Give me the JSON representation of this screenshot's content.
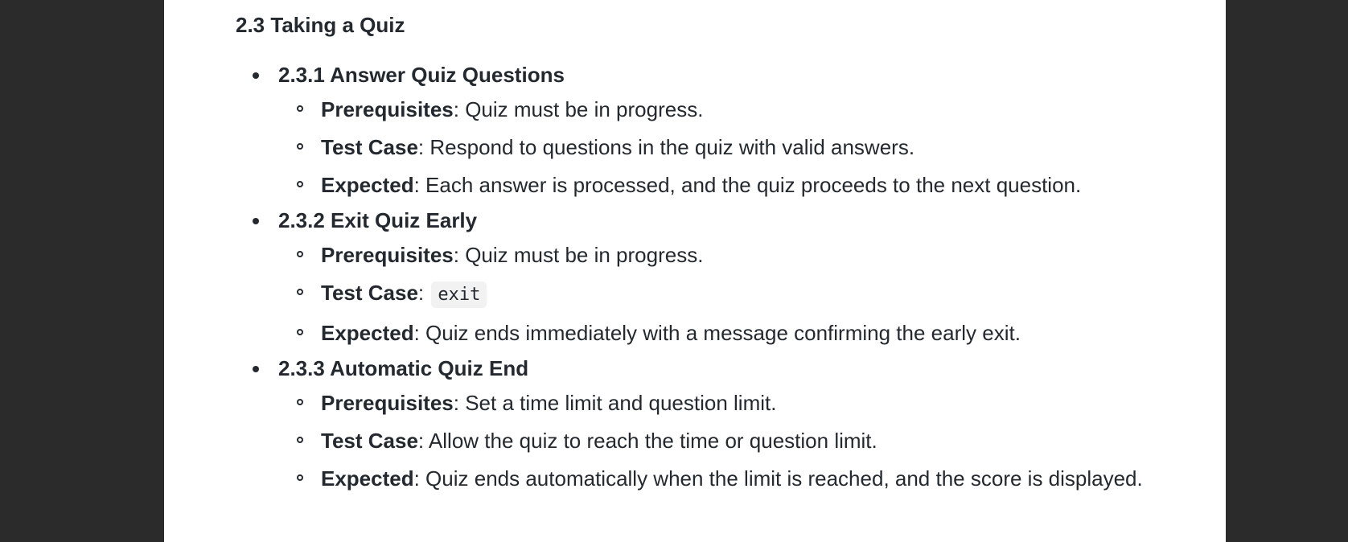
{
  "section": {
    "title": "2.3 Taking a Quiz"
  },
  "items": [
    {
      "heading": "2.3.1 Answer Quiz Questions",
      "prereq_label": "Prerequisites",
      "prereq_text": ": Quiz must be in progress.",
      "test_label": "Test Case",
      "test_text": ": Respond to questions in the quiz with valid answers.",
      "expected_label": "Expected",
      "expected_text": ": Each answer is processed, and the quiz proceeds to the next question."
    },
    {
      "heading": "2.3.2 Exit Quiz Early",
      "prereq_label": "Prerequisites",
      "prereq_text": ": Quiz must be in progress.",
      "test_label": "Test Case",
      "test_sep": ": ",
      "test_code": "exit",
      "expected_label": "Expected",
      "expected_text": ": Quiz ends immediately with a message confirming the early exit."
    },
    {
      "heading": "2.3.3 Automatic Quiz End",
      "prereq_label": "Prerequisites",
      "prereq_text": ": Set a time limit and question limit.",
      "test_label": "Test Case",
      "test_text": ": Allow the quiz to reach the time or question limit.",
      "expected_label": "Expected",
      "expected_text": ": Quiz ends automatically when the limit is reached, and the score is displayed."
    }
  ]
}
